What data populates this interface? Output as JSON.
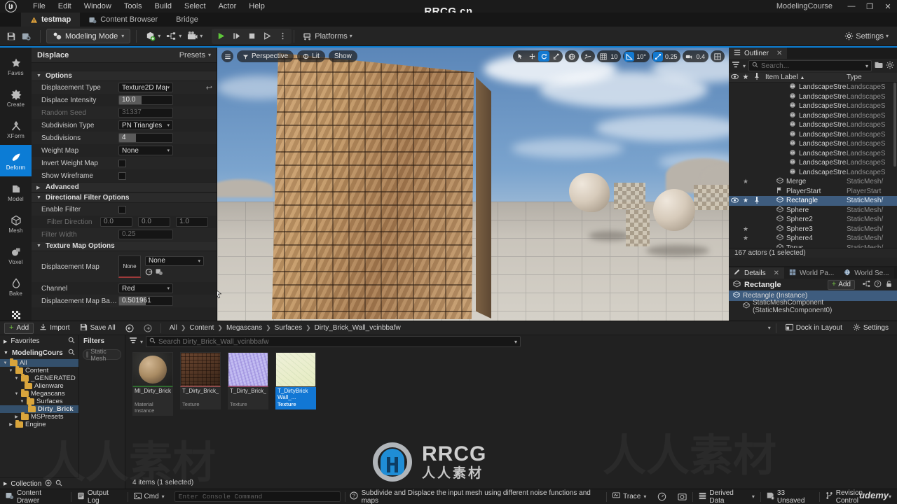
{
  "window": {
    "project_name": "ModelingCourse",
    "minimize": "—",
    "maximize": "❐",
    "close": "✕",
    "watermark_top": "RRCG.cn",
    "watermark_brand": "RRCG",
    "watermark_cn": "人人素材",
    "watermark_udemy": "udemy"
  },
  "menu": {
    "items": [
      "File",
      "Edit",
      "Window",
      "Tools",
      "Build",
      "Select",
      "Actor",
      "Help"
    ]
  },
  "tabs": [
    {
      "label": "testmap",
      "icon": "level-icon",
      "active": true
    },
    {
      "label": "Content Browser",
      "icon": "content-browser-icon",
      "active": false
    },
    {
      "label": "Bridge",
      "icon": "bridge-icon",
      "active": false
    }
  ],
  "toolbar": {
    "save_icon": "save-icon",
    "browse_icon": "browse-content-icon",
    "mode_label": "Modeling Mode",
    "create_icon": "add-actor-icon",
    "blueprint_icon": "blueprints-icon",
    "cinematics_icon": "cinematics-icon",
    "play_icon": "play-icon",
    "skip_icon": "skip-icon",
    "stop_icon": "stop-icon",
    "eject_icon": "eject-icon",
    "more_icon": "more-options-icon",
    "platforms_label": "Platforms",
    "settings_label": "Settings"
  },
  "modebar": [
    {
      "label": "Faves",
      "icon": "star-icon",
      "active": false
    },
    {
      "label": "Create",
      "icon": "create-icon",
      "active": false
    },
    {
      "label": "XForm",
      "icon": "xform-icon",
      "active": false
    },
    {
      "label": "Deform",
      "icon": "deform-icon",
      "active": true
    },
    {
      "label": "Model",
      "icon": "model-icon",
      "active": false
    },
    {
      "label": "Mesh",
      "icon": "mesh-icon",
      "active": false
    },
    {
      "label": "Voxel",
      "icon": "voxel-icon",
      "active": false
    },
    {
      "label": "Bake",
      "icon": "bake-icon",
      "active": false
    },
    {
      "label": "UVs",
      "icon": "uvs-icon",
      "active": false
    },
    {
      "label": "",
      "icon": "list-icon",
      "active": false
    }
  ],
  "tool_panel": {
    "title": "Displace",
    "presets_label": "Presets",
    "sections": {
      "options": "Options",
      "advanced": "Advanced",
      "directional": "Directional Filter Options",
      "texture_map": "Texture Map Options"
    },
    "rows": {
      "displacement_type": {
        "label": "Displacement Type",
        "value": "Texture2D Map"
      },
      "displace_intensity": {
        "label": "Displace Intensity",
        "value": "10.0"
      },
      "random_seed": {
        "label": "Random Seed",
        "value": "31337"
      },
      "subdivision_type": {
        "label": "Subdivision Type",
        "value": "PN Triangles"
      },
      "subdivisions": {
        "label": "Subdivisions",
        "value": "4"
      },
      "weight_map": {
        "label": "Weight Map",
        "value": "None"
      },
      "invert_weight_map": {
        "label": "Invert Weight Map"
      },
      "show_wireframe": {
        "label": "Show Wireframe"
      },
      "enable_filter": {
        "label": "Enable Filter"
      },
      "filter_direction": {
        "label": "Filter Direction",
        "x": "0.0",
        "y": "0.0",
        "z": "1.0"
      },
      "filter_width": {
        "label": "Filter Width",
        "value": "0.25"
      },
      "displacement_map": {
        "label": "Displacement Map",
        "thumb": "None",
        "value": "None"
      },
      "channel": {
        "label": "Channel",
        "value": "Red"
      },
      "displacement_base": {
        "label": "Displacement Map Base..",
        "value": "0.501961"
      }
    }
  },
  "viewport": {
    "menu_icon": "viewport-menu-icon",
    "perspective_label": "Perspective",
    "lit_label": "Lit",
    "show_label": "Show",
    "select_icon": "select-tool-icon",
    "move_icon": "move-tool-icon",
    "rotate_icon": "rotate-tool-icon",
    "scale_icon": "scale-tool-icon",
    "world_icon": "world-coords-icon",
    "surface_icon": "surface-snap-icon",
    "grid_snap_value": "10",
    "angle_snap_value": "10°",
    "scale_snap_value": "0.25",
    "camera_speed_value": "0.4",
    "maximize_icon": "maximize-viewport-icon"
  },
  "outliner": {
    "tab_label": "Outliner",
    "search_placeholder": "Search...",
    "columns": {
      "label": "Item Label",
      "type": "Type"
    },
    "sort_arrow": "▲",
    "rows": [
      {
        "label": "LandscapeStreamingl",
        "type": "LandscapeS",
        "icon": "landscape-icon",
        "indent": true
      },
      {
        "label": "LandscapeStreamingl",
        "type": "LandscapeS",
        "icon": "landscape-icon",
        "indent": true
      },
      {
        "label": "LandscapeStreamingl",
        "type": "LandscapeS",
        "icon": "landscape-icon",
        "indent": true
      },
      {
        "label": "LandscapeStreamingl",
        "type": "LandscapeS",
        "icon": "landscape-icon",
        "indent": true
      },
      {
        "label": "LandscapeStreamingl",
        "type": "LandscapeS",
        "icon": "landscape-icon",
        "indent": true
      },
      {
        "label": "LandscapeStreamingl",
        "type": "LandscapeS",
        "icon": "landscape-icon",
        "indent": true
      },
      {
        "label": "LandscapeStreamingl",
        "type": "LandscapeS",
        "icon": "landscape-icon",
        "indent": true
      },
      {
        "label": "LandscapeStreamingl",
        "type": "LandscapeS",
        "icon": "landscape-icon",
        "indent": true
      },
      {
        "label": "LandscapeStreamingl",
        "type": "LandscapeS",
        "icon": "landscape-icon",
        "indent": true
      },
      {
        "label": "LandscapeStreamingl",
        "type": "LandscapeS",
        "icon": "landscape-icon",
        "indent": true
      },
      {
        "label": "Merge",
        "type": "StaticMesh/",
        "icon": "static-mesh-icon",
        "star": true
      },
      {
        "label": "PlayerStart",
        "type": "PlayerStart",
        "icon": "player-start-icon"
      },
      {
        "label": "Rectangle",
        "type": "StaticMesh/",
        "icon": "static-mesh-icon",
        "selected": true,
        "eye": true,
        "star": true,
        "pin": true
      },
      {
        "label": "Sphere",
        "type": "StaticMesh/",
        "icon": "static-mesh-icon"
      },
      {
        "label": "Sphere2",
        "type": "StaticMesh/",
        "icon": "static-mesh-icon"
      },
      {
        "label": "Sphere3",
        "type": "StaticMesh/",
        "icon": "static-mesh-icon",
        "star": true
      },
      {
        "label": "Sphere4",
        "type": "StaticMesh/",
        "icon": "static-mesh-icon",
        "star": true
      },
      {
        "label": "Torus",
        "type": "StaticMesh/",
        "icon": "static-mesh-icon"
      }
    ],
    "footer": "167 actors (1 selected)"
  },
  "details": {
    "tabs": [
      {
        "label": "Details",
        "icon": "details-icon",
        "active": true
      },
      {
        "label": "World Pa...",
        "icon": "world-partition-icon",
        "active": false
      },
      {
        "label": "World Se...",
        "icon": "world-settings-icon",
        "active": false
      }
    ],
    "actor_name": "Rectangle",
    "add_label": "Add",
    "rows": [
      {
        "label": "Rectangle (Instance)",
        "selected": true
      },
      {
        "label": "StaticMeshComponent (StaticMeshComponent0)",
        "selected": false
      }
    ]
  },
  "content_browser": {
    "add_label": "Add",
    "import_label": "Import",
    "save_all_label": "Save All",
    "breadcrumbs": [
      "All",
      "Content",
      "Megascans",
      "Surfaces",
      "Dirty_Brick_Wall_vcinbbafw"
    ],
    "dock_label": "Dock in Layout",
    "settings_label": "Settings",
    "favorites_label": "Favorites",
    "project_label": "ModelingCours",
    "collection_label": "Collection",
    "filters_label": "Filters",
    "filter_chip": "Static Mesh",
    "search_placeholder": "Search Dirty_Brick_Wall_vcinbbafw",
    "tree": [
      {
        "label": "All",
        "depth": 0,
        "expanded": true,
        "selected": true
      },
      {
        "label": "Content",
        "depth": 1,
        "expanded": true
      },
      {
        "label": "_GENERATED",
        "depth": 2,
        "expanded": true
      },
      {
        "label": "Alienware",
        "depth": 3
      },
      {
        "label": "Megascans",
        "depth": 2,
        "expanded": true
      },
      {
        "label": "Surfaces",
        "depth": 3,
        "expanded": true
      },
      {
        "label": "Dirty_Brick",
        "depth": 4,
        "selected": true
      },
      {
        "label": "MSPresets",
        "depth": 2,
        "collapsed": true
      },
      {
        "label": "Engine",
        "depth": 1,
        "collapsed": true
      }
    ],
    "assets": [
      {
        "name": "MI_Dirty_Brick_Wall_...",
        "type": "Material Instance",
        "selected": false
      },
      {
        "name": "T_Dirty_Brick_Wall_...",
        "type": "Texture",
        "selected": false
      },
      {
        "name": "T_Dirty_Brick_Wall_...",
        "type": "Texture",
        "selected": false
      },
      {
        "name": "T_DirtyBrick Wall_...",
        "type": "Texture",
        "selected": true
      }
    ],
    "count_label": "4 items (1 selected)"
  },
  "status_bar": {
    "content_drawer": "Content Drawer",
    "output_log": "Output Log",
    "cmd_label": "Cmd",
    "console_placeholder": "Enter Console Command",
    "message": "Subdivide and Displace the input mesh using different noise functions and maps",
    "trace_label": "Trace",
    "derived_data_label": "Derived Data",
    "unsaved_label": "33 Unsaved",
    "revision_label": "Revision Control"
  },
  "colors": {
    "accent_blue": "#0d7fd4",
    "selection_blue": "#3e5c7e",
    "asset_selected": "#1277d4",
    "green": "#73c143",
    "folder": "#d9a53c"
  }
}
